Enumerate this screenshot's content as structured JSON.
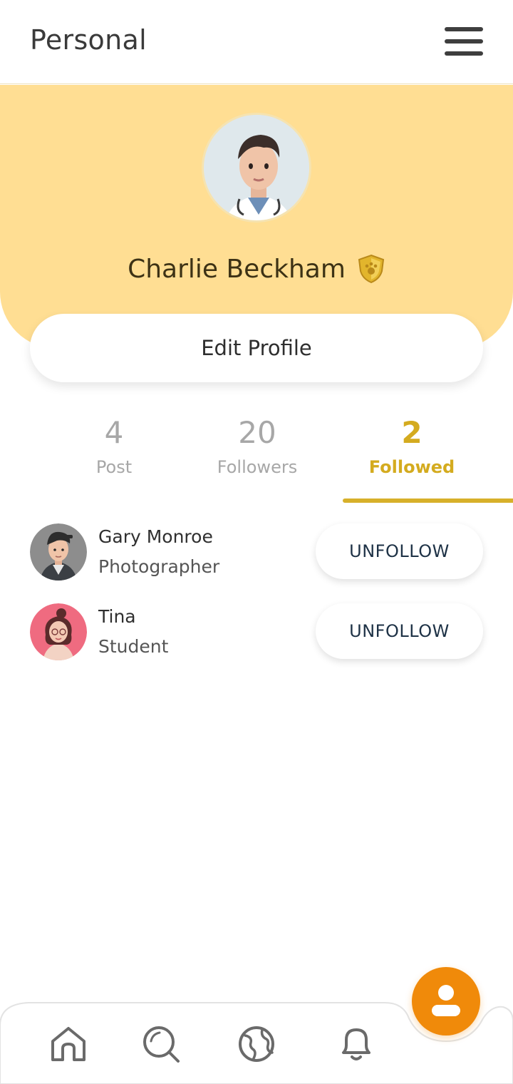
{
  "header": {
    "title": "Personal"
  },
  "profile": {
    "name": "Charlie Beckham",
    "edit_label": "Edit Profile"
  },
  "stats": [
    {
      "value": "4",
      "label": "Post"
    },
    {
      "value": "20",
      "label": "Followers"
    },
    {
      "value": "2",
      "label": "Followed",
      "active": true
    }
  ],
  "followed": [
    {
      "name": "Gary Monroe",
      "role": "Photographer",
      "action": "UNFOLLOW"
    },
    {
      "name": "Tina",
      "role": "Student",
      "action": "UNFOLLOW"
    }
  ],
  "nav": {
    "items": [
      "home-icon",
      "search-icon",
      "globe-icon",
      "bell-icon"
    ],
    "fab": "profile-icon"
  },
  "colors": {
    "banner": "#ffde93",
    "accent": "#d4ab1f",
    "fab": "#f08a0a",
    "unfollow_text": "#1e3246"
  }
}
